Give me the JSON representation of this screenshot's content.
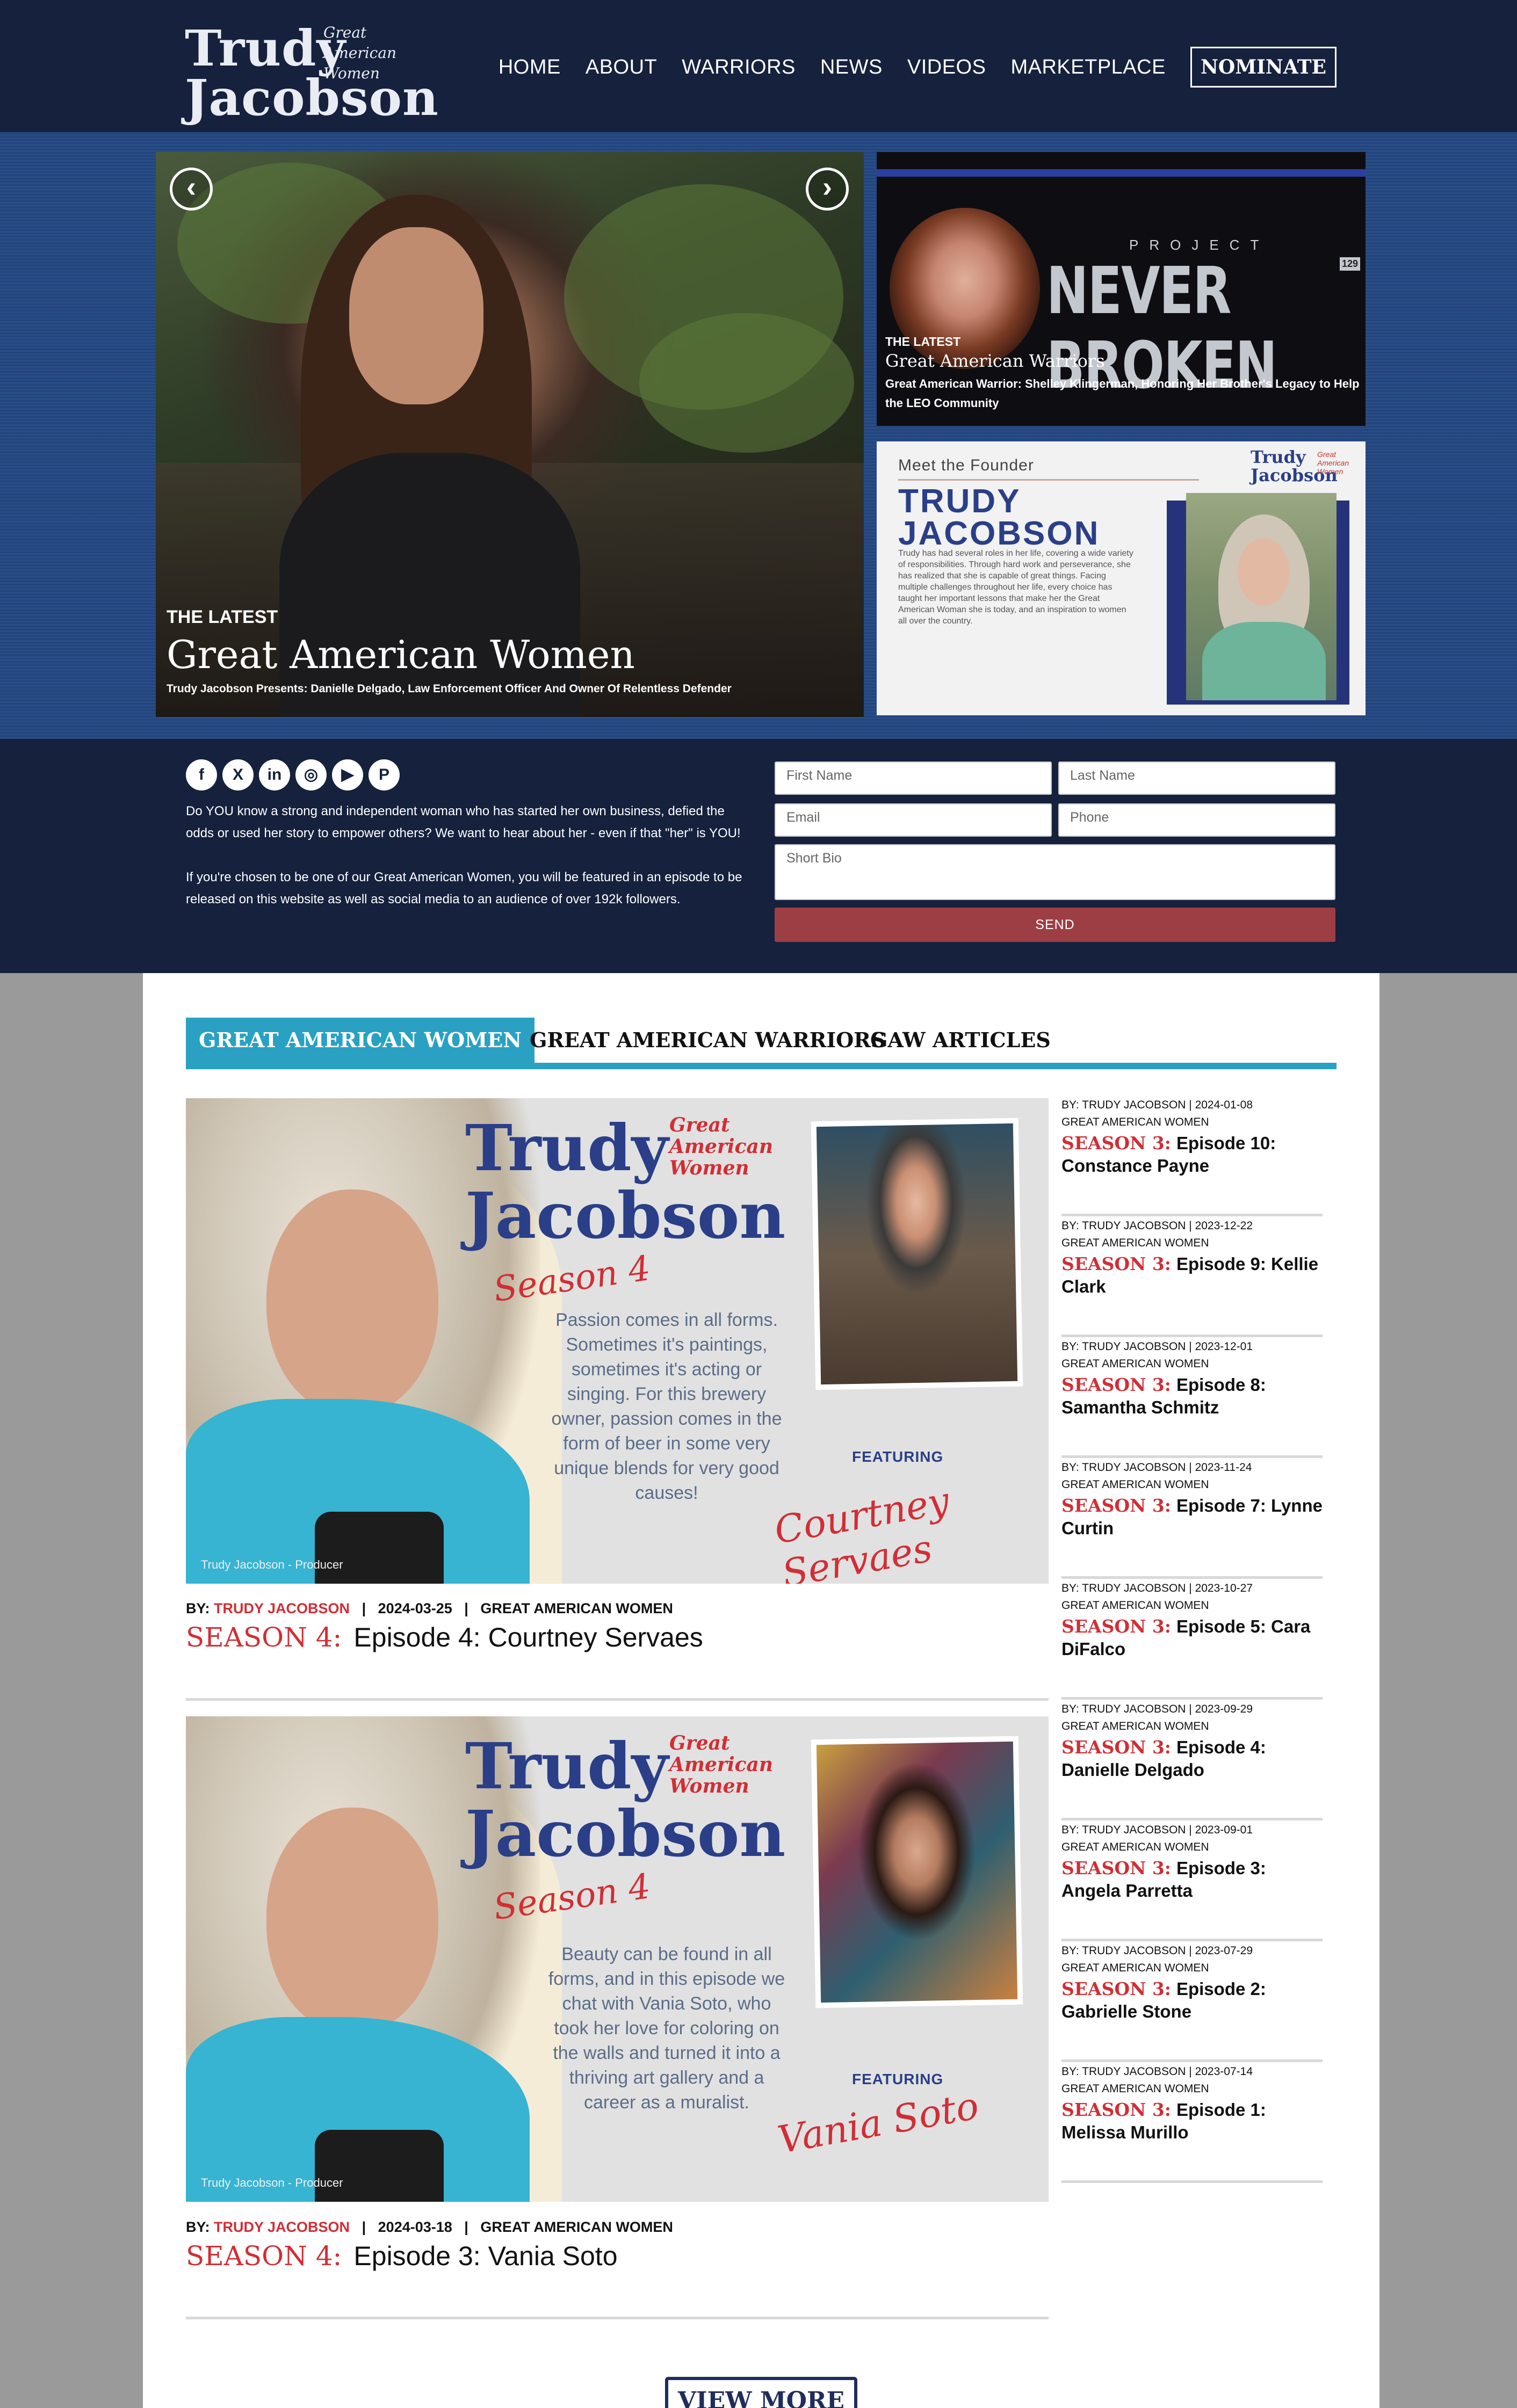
{
  "header": {
    "logo_line1": "Trudy",
    "logo_line2": "Jacobson",
    "logo_tag": "Great American Women",
    "nav": [
      "HOME",
      "ABOUT",
      "WARRIORS",
      "NEWS",
      "VIDEOS",
      "MARKETPLACE"
    ],
    "cta": "NOMINATE"
  },
  "hero": {
    "main": {
      "eyebrow": "THE LATEST",
      "title": "Great American Women",
      "subtitle": "Trudy Jacobson Presents: Danielle Delgado, Law Enforcement Officer And Owner Of Relentless Defender"
    },
    "warriors": {
      "project": "PROJECT",
      "brand": "NEVER BROKEN",
      "badge": "129",
      "eyebrow": "THE LATEST",
      "title": "Great American Warriors",
      "subtitle": "Great American Warrior: Shelley Klingerman, Honoring Her Brother's Legacy to Help the LEO Community"
    },
    "founder": {
      "meet": "Meet the Founder",
      "name": "TRUDY JACOBSON",
      "bio": "Trudy has had several roles in her life, covering a wide variety of responsibilities. Through hard work and perseverance, she has realized that she is capable of great things. Facing multiple challenges throughout her life, every choice has taught her important lessons that make her the Great American Woman she is today, and an inspiration to women all over the country.",
      "logo": "Trudy Jacobson",
      "logo_tag": "Great American Women"
    }
  },
  "band": {
    "social": [
      "f",
      "X",
      "in",
      "◎",
      "▶",
      "P"
    ],
    "para1": "Do YOU know a strong and independent woman who has started her own business, defied the odds or used her story to empower others? We want to hear about her - even if that \"her\" is YOU!",
    "para2": "If you're chosen to be one of our Great American Women, you will be featured in an episode to be released on this website as well as social media to an audience of over 192k followers.",
    "form": {
      "first_name": "First Name",
      "last_name": "Last Name",
      "email": "Email",
      "phone": "Phone",
      "bio": "Short Bio",
      "send": "SEND"
    }
  },
  "tabs": [
    "GREAT AMERICAN WOMEN",
    "GREAT AMERICAN WARRIORS",
    "GAW ARTICLES"
  ],
  "cards": [
    {
      "image": {
        "logo": "Trudy Jacobson",
        "logo_tag": "Great American Women",
        "season": "Season 4",
        "blurb": "Passion comes in all forms. Sometimes it's paintings, sometimes it's acting or singing.  For this  brewery owner, passion comes in the form of beer in some very unique blends for very good causes!",
        "featuring": "FEATURING",
        "guest": "Courtney Servaes",
        "credit": "Trudy Jacobson - Producer"
      },
      "by": "BY:",
      "author": "TRUDY JACOBSON",
      "date": "2024-03-25",
      "category": "GREAT AMERICAN WOMEN",
      "season_label": "SEASON 4:",
      "title": "Episode 4: Courtney Servaes"
    },
    {
      "image": {
        "logo": "Trudy Jacobson",
        "logo_tag": "Great American Women",
        "season": "Season 4",
        "blurb": "Beauty can be found in all forms, and in this episode we chat with Vania Soto, who took her love for coloring on the walls and turned it into a thriving art gallery and a career as a muralist.",
        "featuring": "FEATURING",
        "guest": "Vania Soto",
        "credit": "Trudy Jacobson - Producer"
      },
      "by": "BY:",
      "author": "TRUDY JACOBSON",
      "date": "2024-03-18",
      "category": "GREAT AMERICAN WOMEN",
      "season_label": "SEASON 4:",
      "title": "Episode 3: Vania Soto"
    }
  ],
  "sidebar": [
    {
      "meta": "BY: TRUDY JACOBSON   |   2024-01-08",
      "category": "GREAT AMERICAN WOMEN",
      "season_label": "SEASON 3:",
      "title": "Episode 10: Constance Payne"
    },
    {
      "meta": "BY: TRUDY JACOBSON   |   2023-12-22",
      "category": "GREAT AMERICAN WOMEN",
      "season_label": "SEASON 3:",
      "title": "Episode 9: Kellie Clark"
    },
    {
      "meta": "BY: TRUDY JACOBSON   |   2023-12-01",
      "category": "GREAT AMERICAN WOMEN",
      "season_label": "SEASON 3:",
      "title": "Episode 8: Samantha Schmitz"
    },
    {
      "meta": "BY: TRUDY JACOBSON   |   2023-11-24",
      "category": "GREAT AMERICAN WOMEN",
      "season_label": "SEASON 3:",
      "title": "Episode 7: Lynne Curtin"
    },
    {
      "meta": "BY: TRUDY JACOBSON   |   2023-10-27",
      "category": "GREAT AMERICAN WOMEN",
      "season_label": "SEASON 3:",
      "title": "Episode 5: Cara DiFalco"
    },
    {
      "meta": "BY: TRUDY JACOBSON   |   2023-09-29",
      "category": "GREAT AMERICAN WOMEN",
      "season_label": "SEASON 3:",
      "title": "Episode 4: Danielle Delgado"
    },
    {
      "meta": "BY: TRUDY JACOBSON   |   2023-09-01",
      "category": "GREAT AMERICAN WOMEN",
      "season_label": "SEASON 3:",
      "title": "Episode 3: Angela Parretta"
    },
    {
      "meta": "BY: TRUDY JACOBSON   |   2023-07-29",
      "category": "GREAT AMERICAN WOMEN",
      "season_label": "SEASON 3:",
      "title": "Episode 2: Gabrielle Stone"
    },
    {
      "meta": "BY: TRUDY JACOBSON   |   2023-07-14",
      "category": "GREAT AMERICAN WOMEN",
      "season_label": "SEASON 3:",
      "title": "Episode 1: Melissa Murillo"
    }
  ],
  "view_more": "VIEW MORE"
}
